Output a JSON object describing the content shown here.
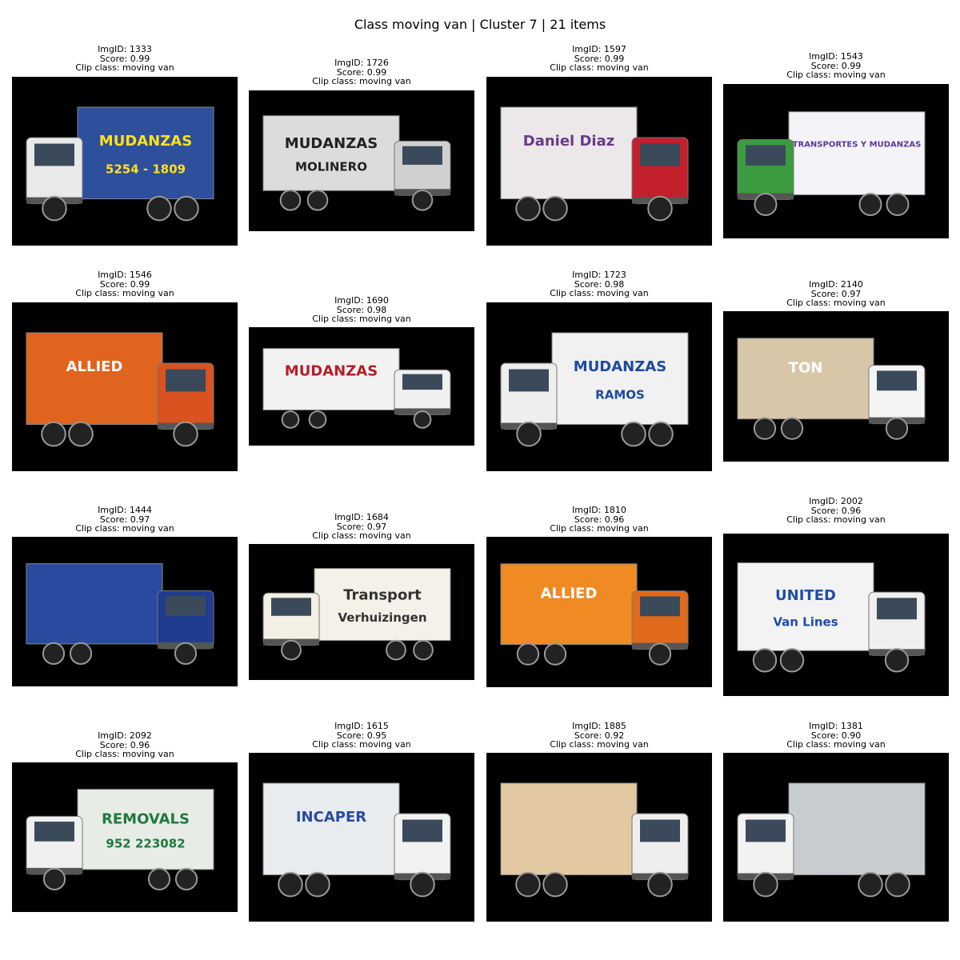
{
  "figure_title": "Class moving van | Cluster 7 | 21 items",
  "items": [
    {
      "img_id": "ImgID: 1333",
      "score": "Score: 0.99",
      "clip": "Clip class: moving van",
      "box_text": "MUDANZAS",
      "box_text2": "5254 - 1809",
      "cab_color": "#e9e9e9",
      "box_color": "#2d4f9c",
      "text_color": "#ffe11a"
    },
    {
      "img_id": "ImgID: 1726",
      "score": "Score: 0.99",
      "clip": "Clip class: moving van",
      "box_text": "MUDANZAS",
      "box_text2": "MOLINERO",
      "cab_color": "#d0d0d0",
      "box_color": "#dcdcdc",
      "text_color": "#222222"
    },
    {
      "img_id": "ImgID: 1597",
      "score": "Score: 0.99",
      "clip": "Clip class: moving van",
      "box_text": "Daniel Diaz",
      "box_text2": "",
      "cab_color": "#c2202a",
      "box_color": "#ece8ea",
      "text_color": "#6a3a8a"
    },
    {
      "img_id": "ImgID: 1543",
      "score": "Score: 0.99",
      "clip": "Clip class: moving van",
      "box_text": "TRANSPORTES Y MUDANZAS",
      "box_text2": "",
      "cab_color": "#3a9c3e",
      "box_color": "#f4f4f8",
      "text_color": "#5a3a9a"
    },
    {
      "img_id": "ImgID: 1546",
      "score": "Score: 0.99",
      "clip": "Clip class: moving van",
      "box_text": "ALLIED",
      "box_text2": "",
      "cab_color": "#d9521f",
      "box_color": "#e0631e",
      "text_color": "#ffffff"
    },
    {
      "img_id": "ImgID: 1690",
      "score": "Score: 0.98",
      "clip": "Clip class: moving van",
      "box_text": "MUDANZAS",
      "box_text2": "",
      "cab_color": "#f0f0f0",
      "box_color": "#f2f2f2",
      "text_color": "#b3202a"
    },
    {
      "img_id": "ImgID: 1723",
      "score": "Score: 0.98",
      "clip": "Clip class: moving van",
      "box_text": "MUDANZAS",
      "box_text2": "RAMOS",
      "cab_color": "#eeeeee",
      "box_color": "#f1f1f1",
      "text_color": "#1d4aa0"
    },
    {
      "img_id": "ImgID: 2140",
      "score": "Score: 0.97",
      "clip": "Clip class: moving van",
      "box_text": "TON",
      "box_text2": "",
      "cab_color": "#f4f4f4",
      "box_color": "#d7c7a8",
      "text_color": "#ffffff"
    },
    {
      "img_id": "ImgID: 1444",
      "score": "Score: 0.97",
      "clip": "Clip class: moving van",
      "box_text": "",
      "box_text2": "",
      "cab_color": "#1f3c8f",
      "box_color": "#2a4aa0",
      "text_color": "#ffffff"
    },
    {
      "img_id": "ImgID: 1684",
      "score": "Score: 0.97",
      "clip": "Clip class: moving van",
      "box_text": "Transport",
      "box_text2": "Verhuizingen",
      "cab_color": "#f3efe4",
      "box_color": "#f4f1e8",
      "text_color": "#333333"
    },
    {
      "img_id": "ImgID: 1810",
      "score": "Score: 0.96",
      "clip": "Clip class: moving van",
      "box_text": "ALLIED",
      "box_text2": "",
      "cab_color": "#e06a1c",
      "box_color": "#f08a22",
      "text_color": "#ffffff"
    },
    {
      "img_id": "ImgID: 2002",
      "score": "Score: 0.96",
      "clip": "Clip class: moving van",
      "box_text": "UNITED",
      "box_text2": "Van Lines",
      "cab_color": "#efefef",
      "box_color": "#f3f3f3",
      "text_color": "#1f4ea8"
    },
    {
      "img_id": "ImgID: 2092",
      "score": "Score: 0.96",
      "clip": "Clip class: moving van",
      "box_text": "REMOVALS",
      "box_text2": "952 223082",
      "cab_color": "#f0f0f0",
      "box_color": "#e8ece6",
      "text_color": "#1e7a3e"
    },
    {
      "img_id": "ImgID: 1615",
      "score": "Score: 0.95",
      "clip": "Clip class: moving van",
      "box_text": "INCAPER",
      "box_text2": "",
      "cab_color": "#f2f2f2",
      "box_color": "#e9ecef",
      "text_color": "#2a4aa0"
    },
    {
      "img_id": "ImgID: 1885",
      "score": "Score: 0.92",
      "clip": "Clip class: moving van",
      "box_text": "",
      "box_text2": "",
      "cab_color": "#eeeeee",
      "box_color": "#e2c9a2",
      "text_color": "#000000"
    },
    {
      "img_id": "ImgID: 1381",
      "score": "Score: 0.90",
      "clip": "Clip class: moving van",
      "box_text": "",
      "box_text2": "",
      "cab_color": "#f2f2f2",
      "box_color": "#c9ccd0",
      "text_color": "#000000"
    }
  ]
}
